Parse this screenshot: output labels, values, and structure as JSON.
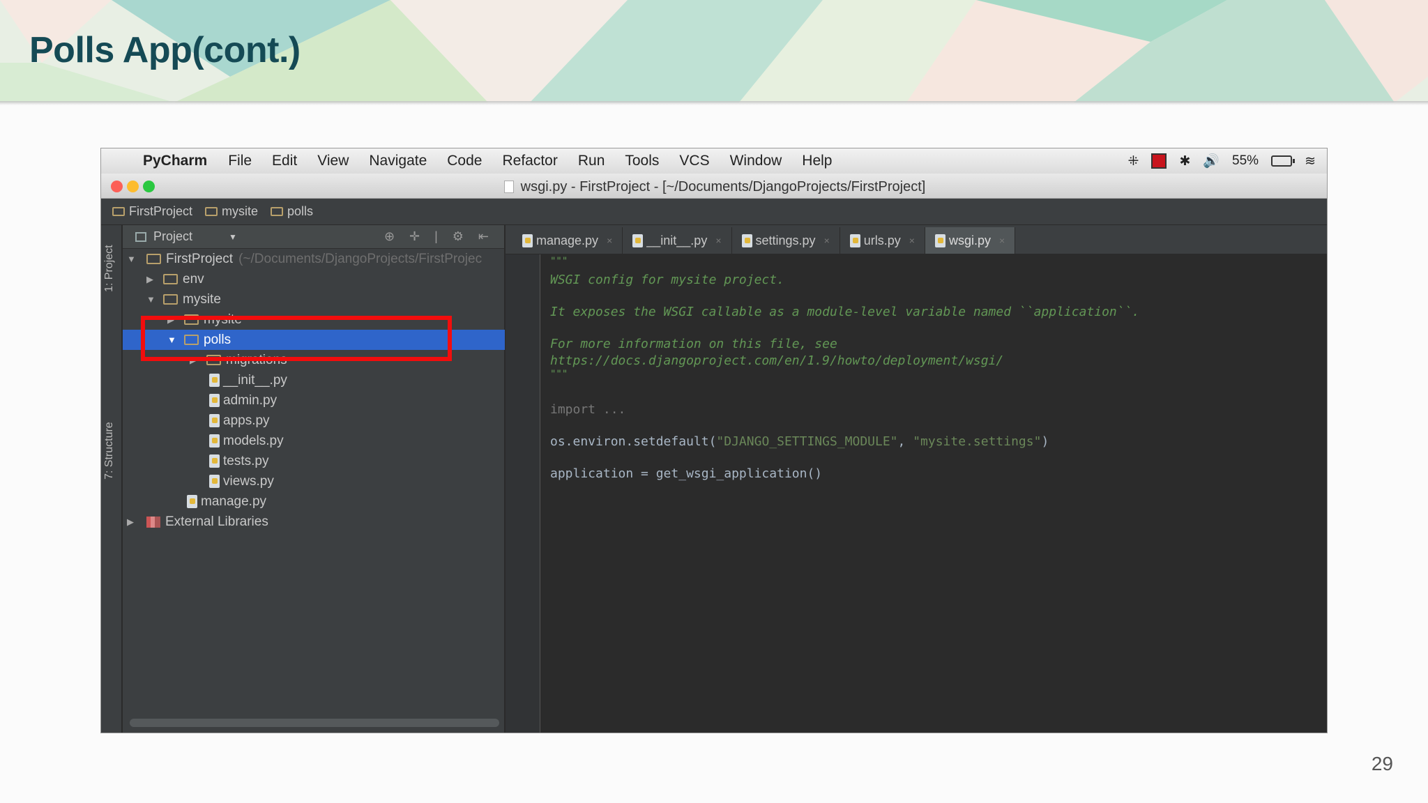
{
  "slide": {
    "title": "Polls App(cont.)",
    "page_number": "29"
  },
  "menubar": {
    "app": "PyCharm",
    "items": [
      "File",
      "Edit",
      "View",
      "Navigate",
      "Code",
      "Refactor",
      "Run",
      "Tools",
      "VCS",
      "Window",
      "Help"
    ],
    "battery": "55%"
  },
  "window": {
    "title": "wsgi.py - FirstProject - [~/Documents/DjangoProjects/FirstProject]"
  },
  "breadcrumb": [
    "FirstProject",
    "mysite",
    "polls"
  ],
  "toolstrip": {
    "project_tab": "1: Project",
    "structure_tab": "7: Structure"
  },
  "project_panel": {
    "header": "Project",
    "root_label": "FirstProject",
    "root_hint": "(~/Documents/DjangoProjects/FirstProjec",
    "tree": [
      "env",
      "mysite",
      "mysite",
      "polls",
      "migrations",
      "__init__.py",
      "admin.py",
      "apps.py",
      "models.py",
      "tests.py",
      "views.py",
      "manage.py",
      "External Libraries"
    ]
  },
  "editor": {
    "tabs": [
      "manage.py",
      "__init__.py",
      "settings.py",
      "urls.py",
      "wsgi.py"
    ],
    "active_tab": "wsgi.py",
    "code": {
      "doc_open": "\"\"\"",
      "doc1": "WSGI config for mysite project.",
      "doc2": "It exposes the WSGI callable as a module-level variable named ``application``.",
      "doc3": "For more information on this file, see",
      "doc4": "https://docs.djangoproject.com/en/1.9/howto/deployment/wsgi/",
      "doc_close": "\"\"\"",
      "import": "import ...",
      "env_prefix": "os.environ.setdefault(",
      "env_arg1": "\"DJANGO_SETTINGS_MODULE\"",
      "env_sep": ", ",
      "env_arg2": "\"mysite.settings\"",
      "env_suffix": ")",
      "app_line": "application = get_wsgi_application()"
    }
  }
}
